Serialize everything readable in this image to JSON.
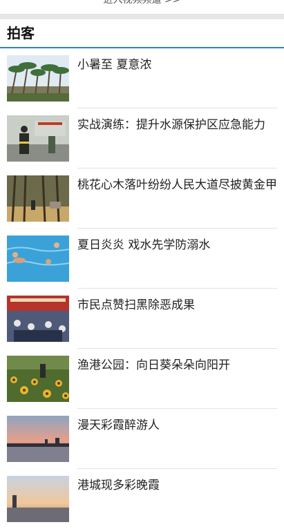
{
  "top_link": {
    "label": "进入视频频道 >>"
  },
  "section": {
    "title": "拍客"
  },
  "items": [
    {
      "title": "小暑至 夏意浓",
      "image": "palm-trees-photo"
    },
    {
      "title": "实战演练：提升水源保护区应急能力",
      "image": "firefighter-drill-photo"
    },
    {
      "title": "桃花心木落叶纷纷人民大道尽披黄金甲",
      "image": "mahogany-avenue-photo"
    },
    {
      "title": "夏日炎炎 戏水先学防溺水",
      "image": "swimming-pool-photo"
    },
    {
      "title": "市民点赞扫黑除恶成果",
      "image": "exhibition-crowd-photo"
    },
    {
      "title": "渔港公园：向日葵朵朵向阳开",
      "image": "sunflower-park-photo"
    },
    {
      "title": "漫天彩霞醉游人",
      "image": "sunset-clouds-photo"
    },
    {
      "title": "港城现多彩晚霞",
      "image": "harbor-sunset-photo"
    }
  ]
}
